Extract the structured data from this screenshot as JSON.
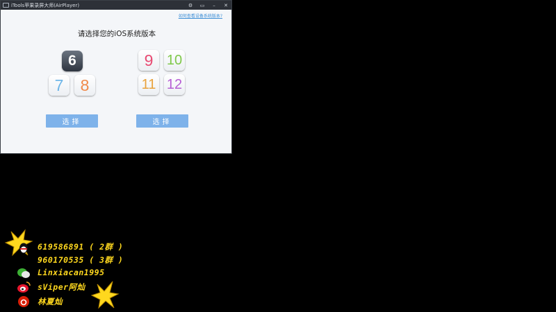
{
  "window": {
    "title": "iTools苹果录屏大师(AirPlayer)",
    "controls": {
      "settings": "⚙",
      "restore": "▭",
      "minimize": "–",
      "close": "✕"
    },
    "help_link": "如何查看设备系统版本?"
  },
  "main": {
    "heading": "请选择您的iOS系统版本",
    "group_left": {
      "versions": [
        "6",
        "7",
        "8"
      ],
      "button_label": "选择"
    },
    "group_right": {
      "versions": [
        "9",
        "10",
        "11",
        "12"
      ],
      "button_label": "选择"
    }
  },
  "overlay": {
    "contacts": [
      {
        "icon": "qq-icon",
        "text": "619586891 ( 2群 )"
      },
      {
        "icon": "qq-icon",
        "text": "960170535 ( 3群 )"
      },
      {
        "icon": "wechat-icon",
        "text": "Linxiacan1995"
      },
      {
        "icon": "weibo-icon",
        "text": "sViper阿灿"
      },
      {
        "icon": "netease-music-icon",
        "text": "林夏灿"
      }
    ],
    "colors": {
      "text": "#ffd81e"
    }
  }
}
